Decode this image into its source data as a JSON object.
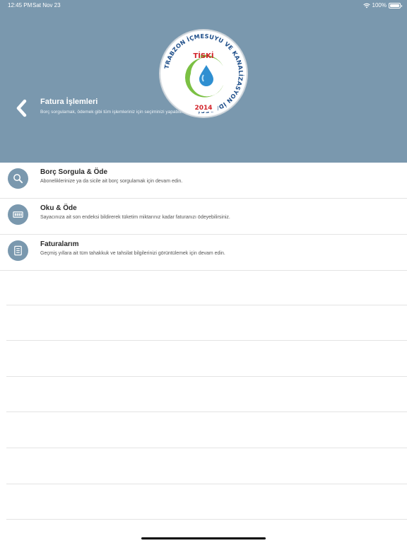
{
  "status_bar": {
    "time": "12:45 PM",
    "date": "Sat Nov 23",
    "battery": "100%"
  },
  "header": {
    "title": "Fatura İşlemleri",
    "subtitle": "Borç sorgulamak, ödemek gibi tüm işlemleriniz için seçiminizi yapabilirsiniz.",
    "background_color": "#7a98ae"
  },
  "logo": {
    "center_text": "TİSKİ",
    "ring_text": "TRABZON İÇMESUYU VE KANALİZASYON İDARESİ",
    "year": "2014"
  },
  "menu": {
    "items": [
      {
        "title": "Borç Sorgula & Öde",
        "description": "Aboneliklerinize ya da sicile ait borç sorgulamak için devam edin.",
        "icon": "search-icon"
      },
      {
        "title": "Oku & Öde",
        "description": "Sayacınıza ait son endeksi bildirerek tüketim miktarınız kadar faturanızı ödeyebilirsiniz.",
        "icon": "meter-icon"
      },
      {
        "title": "Faturalarım",
        "description": "Geçmiş yıllara ait tüm tahakkuk ve tahsilat bilgilerinizi görüntülemek için devam edin.",
        "icon": "invoice-icon"
      }
    ]
  }
}
